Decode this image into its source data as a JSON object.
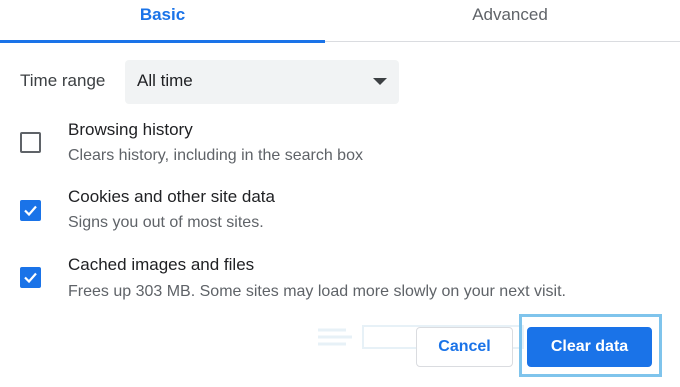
{
  "tabs": [
    {
      "label": "Basic",
      "active": true
    },
    {
      "label": "Advanced",
      "active": false
    }
  ],
  "time_range": {
    "label": "Time range",
    "value": "All time"
  },
  "options": [
    {
      "title": "Browsing history",
      "description": "Clears history, including in the search box",
      "checked": false
    },
    {
      "title": "Cookies and other site data",
      "description": "Signs you out of most sites.",
      "checked": true
    },
    {
      "title": "Cached images and files",
      "description": "Frees up 303 MB. Some sites may load more slowly on your next visit.",
      "checked": true
    }
  ],
  "buttons": {
    "cancel": "Cancel",
    "clear": "Clear data"
  },
  "colors": {
    "accent": "#1a73e8",
    "highlight": "#7fc4ec"
  },
  "icons": {
    "dropdown": "caret-down-icon",
    "check": "checkmark-icon"
  }
}
